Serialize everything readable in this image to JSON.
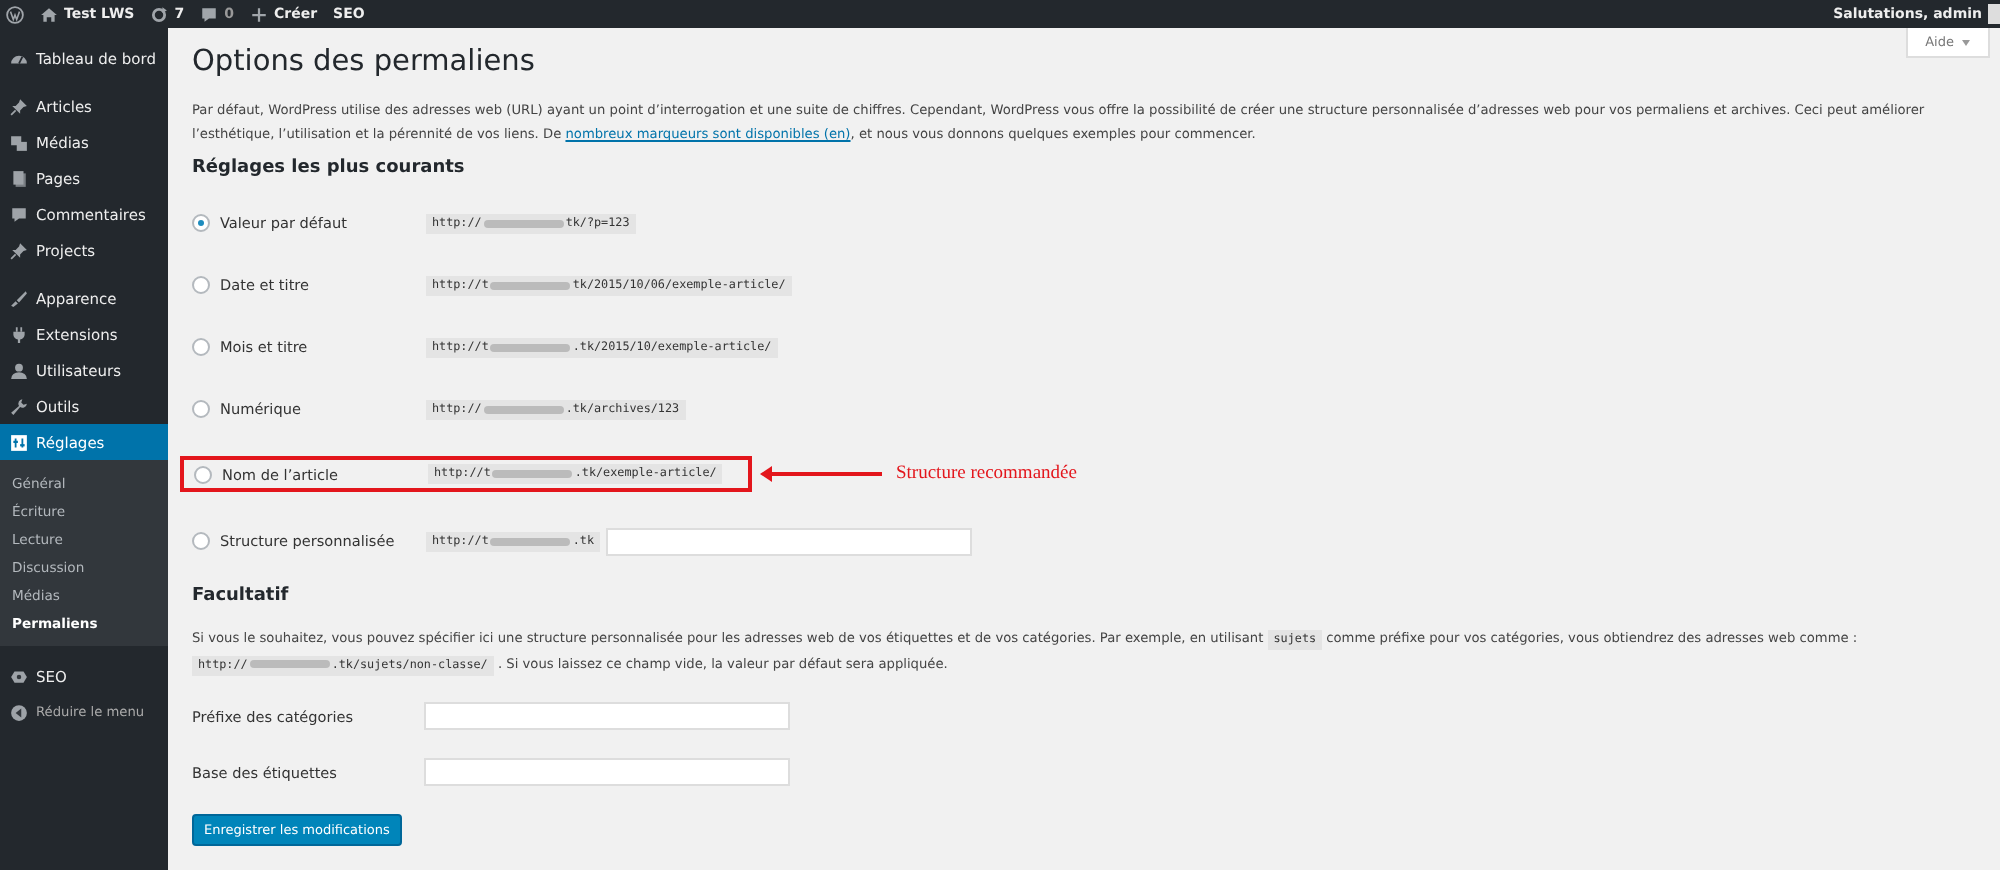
{
  "admin_bar": {
    "site": "Test LWS",
    "updates": "7",
    "comments": "0",
    "new": "Créer",
    "seo": "SEO",
    "greeting": "Salutations, admin"
  },
  "sidebar": {
    "items": [
      {
        "label": "Tableau de bord",
        "selected": false
      },
      {
        "label": "Articles",
        "selected": false
      },
      {
        "label": "Médias",
        "selected": false
      },
      {
        "label": "Pages",
        "selected": false
      },
      {
        "label": "Commentaires",
        "selected": false
      },
      {
        "label": "Projects",
        "selected": false
      },
      {
        "label": "Apparence",
        "selected": false
      },
      {
        "label": "Extensions",
        "selected": false
      },
      {
        "label": "Utilisateurs",
        "selected": false
      },
      {
        "label": "Outils",
        "selected": false
      },
      {
        "label": "Réglages",
        "selected": true,
        "children": [
          {
            "label": "Général",
            "selected": false
          },
          {
            "label": "Écriture",
            "selected": false
          },
          {
            "label": "Lecture",
            "selected": false
          },
          {
            "label": "Discussion",
            "selected": false
          },
          {
            "label": "Médias",
            "selected": false
          },
          {
            "label": "Permaliens",
            "selected": true
          }
        ]
      },
      {
        "label": "SEO",
        "selected": false
      },
      {
        "label": "Réduire le menu",
        "selected": false
      }
    ]
  },
  "help_button": "Aide",
  "title": "Options des permaliens",
  "intro": {
    "before": "Par défaut, WordPress utilise des adresses web (URL) ayant un point d’interrogation et une suite de chiffres. Cependant, WordPress vous offre la possibilité de créer une structure personnalisée d’adresses web pour vos permaliens et archives. Ceci peut améliorer l’esthétique, l’utilisation et la pérennité de vos liens. De",
    "link": "nombreux marqueurs sont disponibles (en)",
    "after": ", et nous vous donnons quelques exemples pour commencer."
  },
  "common_heading": "Réglages les plus courants",
  "options": [
    {
      "label": "Valeur par défaut",
      "url_start": "http://",
      "url_end": "tk/?p=123",
      "selected": true,
      "highlighted": false
    },
    {
      "label": "Date et titre",
      "url_start": "http://t",
      "url_end": "tk/2015/10/06/exemple-article/",
      "selected": false,
      "highlighted": false
    },
    {
      "label": "Mois et titre",
      "url_start": "http://t",
      "url_end": ".tk/2015/10/exemple-article/",
      "selected": false,
      "highlighted": false
    },
    {
      "label": "Numérique",
      "url_start": "http://",
      "url_end": ".tk/archives/123",
      "selected": false,
      "highlighted": false
    },
    {
      "label": "Nom de l’article",
      "url_start": "http://t",
      "url_end": ".tk/exemple-article/",
      "selected": false,
      "highlighted": true
    },
    {
      "label": "Structure personnalisée",
      "url_start": "http://t",
      "url_end": ".tk",
      "selected": false,
      "highlighted": false,
      "kind": "custom"
    }
  ],
  "annotation": "Structure recommandée",
  "optional_heading": "Facultatif",
  "optional_text": {
    "before": "Si vous le souhaitez, vous pouvez spécifier ici une structure personnalisée pour les adresses web de vos étiquettes et de vos catégories. Par exemple, en utilisant",
    "code": "sujets",
    "middle": "comme préfixe pour vos catégories, vous obtiendrez des adresses web comme :",
    "url_start": "http://",
    "url_end": ".tk/sujets/non-classe/",
    "after": ". Si vous laissez ce champ vide, la valeur par défaut sera appliquée."
  },
  "fields": [
    {
      "label": "Préfixe des catégories"
    },
    {
      "label": "Base des étiquettes"
    }
  ],
  "save_button": "Enregistrer les modifications"
}
